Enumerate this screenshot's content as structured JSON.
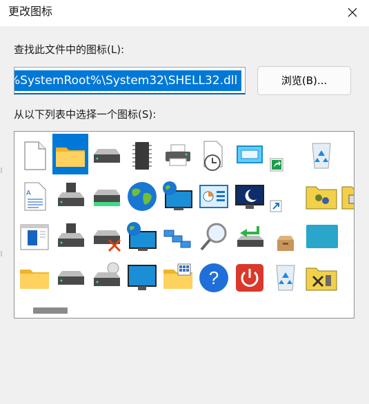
{
  "window": {
    "title": "更改图标"
  },
  "file_label": "查找此文件中的图标(L):",
  "file_path": "%SystemRoot%\\System32\\SHELL32.dll",
  "browse_label": "浏览(B)...",
  "list_label": "从以下列表中选择一个图标(S):",
  "icons": [
    [
      "blank-document-icon",
      "folder-icon",
      "drive-icon",
      "memory-chip-icon",
      "printer-icon",
      "clock-document-icon",
      "window-icon",
      "shortcut-arrow-icon",
      "recycle-bin-icon",
      "folder-partial-icon"
    ],
    [
      "text-document-icon",
      "floppy-drive-icon",
      "removable-drive-icon",
      "globe-icon",
      "network-globe-monitor-icon",
      "control-panel-icon",
      "monitor-moon-icon",
      "shortcut-small-icon",
      "folder-users-icon",
      "folder-printer-icon"
    ],
    [
      "document-window-icon",
      "floppy-drive-2-icon",
      "drive-error-icon",
      "globe-monitor-icon",
      "network-icon",
      "search-magnifier-icon",
      "drive-green-arrow-icon",
      "package-box-icon",
      "teal-screen-icon",
      "folder-partial-2-icon"
    ],
    [
      "folder-2-icon",
      "drive-2-icon",
      "cd-drive-icon",
      "monitor-icon",
      "folder-grid-icon",
      "help-icon",
      "power-icon",
      "recycle-bin-2-icon",
      "folder-tools-icon",
      "server-partial-icon"
    ]
  ]
}
